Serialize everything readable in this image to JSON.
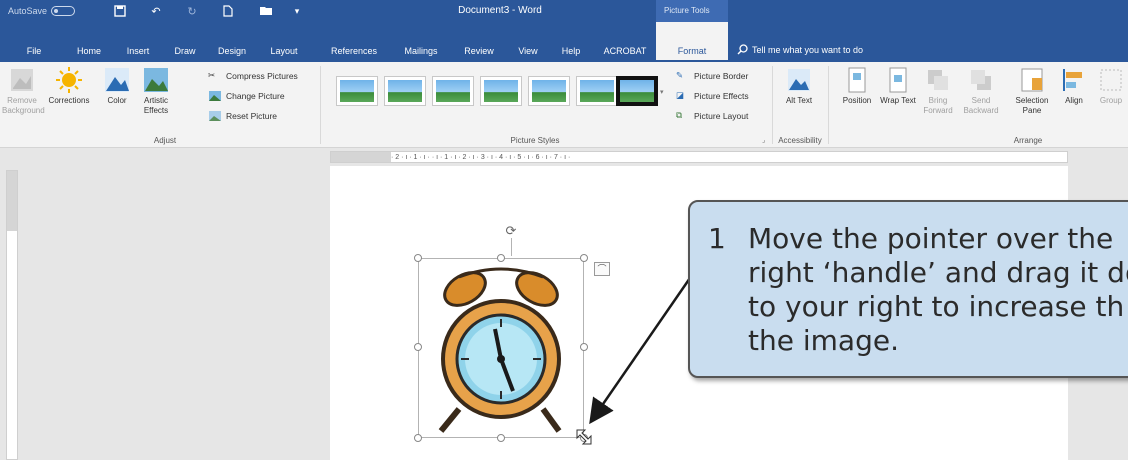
{
  "titlebar": {
    "autosave_label": "AutoSave",
    "autosave_state": "Off",
    "doc_title": "Document3  -  Word",
    "context_group": "Picture Tools"
  },
  "tabs": [
    {
      "label": "File"
    },
    {
      "label": "Home"
    },
    {
      "label": "Insert"
    },
    {
      "label": "Draw"
    },
    {
      "label": "Design"
    },
    {
      "label": "Layout"
    },
    {
      "label": "References"
    },
    {
      "label": "Mailings"
    },
    {
      "label": "Review"
    },
    {
      "label": "View"
    },
    {
      "label": "Help"
    },
    {
      "label": "ACROBAT"
    },
    {
      "label": "Format"
    }
  ],
  "tell_me": "Tell me what you want to do",
  "ribbon": {
    "adjust": {
      "remove_background": "Remove Background",
      "corrections": "Corrections",
      "color": "Color",
      "artistic_effects": "Artistic Effects",
      "compress": "Compress Pictures",
      "change": "Change Picture",
      "reset": "Reset Picture",
      "group_label": "Adjust"
    },
    "styles": {
      "border": "Picture Border",
      "effects": "Picture Effects",
      "layout": "Picture Layout",
      "group_label": "Picture Styles"
    },
    "accessibility": {
      "alt_text": "Alt Text",
      "group_label": "Accessibility"
    },
    "arrange": {
      "position": "Position",
      "wrap_text": "Wrap Text",
      "bring_forward": "Bring Forward",
      "send_backward": "Send Backward",
      "selection_pane": "Selection Pane",
      "align": "Align",
      "group": "Group",
      "group_label": "Arrange"
    }
  },
  "ruler_text": "· 2 · ı · 1 · ı ·   · ı · 1 · ı · 2 · ı · 3 · ı · 4 · ı · 5 · ı · 6 · ı · 7 · ı ·",
  "callout": {
    "number": "1",
    "line1": "Move the pointer over the",
    "line2": "right ‘handle’ and drag it do",
    "line3": "to your right to increase th",
    "line4": "the image."
  },
  "colors": {
    "word_blue": "#2b579a",
    "context_blue": "#3e6bb3",
    "ribbon_bg": "#f3f3f3",
    "callout_bg": "#c9ddef"
  },
  "icons": [
    "save-icon",
    "undo-icon",
    "redo-icon",
    "new-icon",
    "open-icon",
    "search-icon",
    "clock-image-icon",
    "rotate-icon",
    "layout-options-icon",
    "resize-pointer-icon"
  ]
}
